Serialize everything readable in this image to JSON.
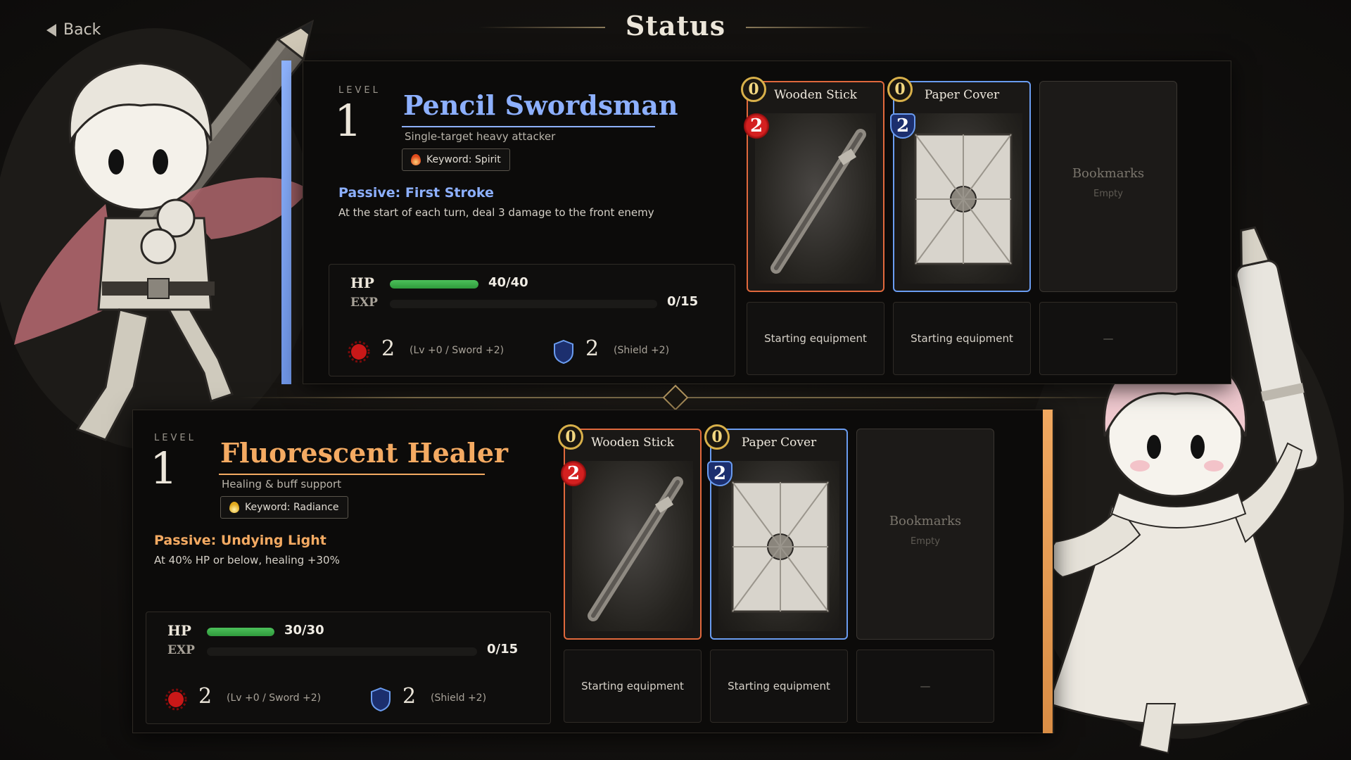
{
  "header": {
    "back_label": "Back",
    "title": "Status"
  },
  "characters": [
    {
      "level_label": "LEVEL",
      "level": "1",
      "name": "Pencil Swordsman",
      "role": "Single-target heavy attacker",
      "keyword": "Keyword: Spirit",
      "passive_title": "Passive: First Stroke",
      "passive_desc": "At the start of each turn, deal 3 damage to the front enemy",
      "hp_label": "HP",
      "hp_text": "40/40",
      "hp_fraction": 1.0,
      "exp_label": "EXP",
      "exp_text": "0/15",
      "exp_fraction": 0.0,
      "attack": "2",
      "attack_note": "(Lv +0 / Sword +2)",
      "defense": "2",
      "defense_note": "(Shield +2)",
      "accent_color": "#8db0ff",
      "cards": [
        {
          "title": "Wooden Stick",
          "cost": "0",
          "power": "2",
          "type": "attack",
          "slot": "Starting equipment"
        },
        {
          "title": "Paper Cover",
          "cost": "0",
          "power": "2",
          "type": "shield",
          "slot": "Starting equipment"
        },
        {
          "title": "Bookmarks",
          "sub": "Empty",
          "type": "empty",
          "slot": "—"
        }
      ]
    },
    {
      "level_label": "LEVEL",
      "level": "1",
      "name": "Fluorescent Healer",
      "role": "Healing & buff support",
      "keyword": "Keyword: Radiance",
      "passive_title": "Passive: Undying Light",
      "passive_desc": "At 40% HP or below, healing +30%",
      "hp_label": "HP",
      "hp_text": "30/30",
      "hp_fraction": 1.0,
      "exp_label": "EXP",
      "exp_text": "0/15",
      "exp_fraction": 0.0,
      "attack": "2",
      "attack_note": "(Lv +0 / Sword +2)",
      "defense": "2",
      "defense_note": "(Shield +2)",
      "accent_color": "#f4aa62",
      "cards": [
        {
          "title": "Wooden Stick",
          "cost": "0",
          "power": "2",
          "type": "attack",
          "slot": "Starting equipment"
        },
        {
          "title": "Paper Cover",
          "cost": "0",
          "power": "2",
          "type": "shield",
          "slot": "Starting equipment"
        },
        {
          "title": "Bookmarks",
          "sub": "Empty",
          "type": "empty",
          "slot": "—"
        }
      ]
    }
  ]
}
